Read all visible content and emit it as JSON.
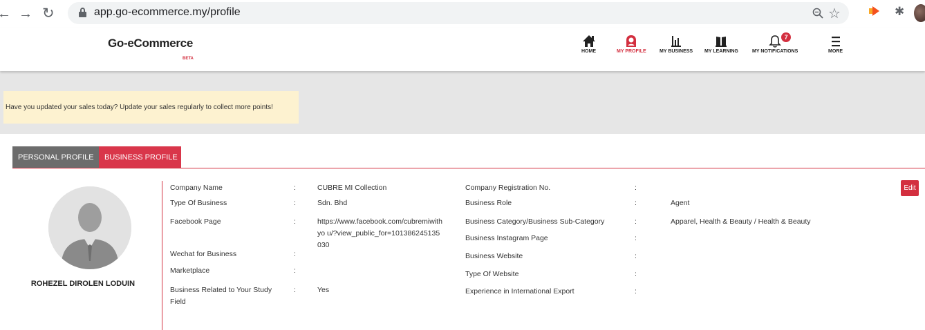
{
  "browser": {
    "url": "app.go-ecommerce.my/profile"
  },
  "header": {
    "logo": "Go-eCommerce",
    "beta": "BETA",
    "menu": [
      {
        "label": "HOME",
        "icon": "home-icon"
      },
      {
        "label": "MY PROFILE",
        "icon": "profile-icon"
      },
      {
        "label": "MY BUSINESS",
        "icon": "business-chart-icon"
      },
      {
        "label": "MY LEARNING",
        "icon": "book-icon"
      },
      {
        "label": "MY NOTIFICATIONS",
        "icon": "bell-icon"
      },
      {
        "label": "MORE",
        "icon": "hamburger-icon"
      }
    ],
    "notification_count": "7"
  },
  "notice": "Have you updated your sales today? Update your sales regularly to collect more points!",
  "tabs": {
    "personal": "PERSONAL PROFILE",
    "business": "BUSINESS PROFILE"
  },
  "profile": {
    "name": "ROHEZEL DIROLEN LODUIN"
  },
  "left_fields": [
    {
      "label": "Company Name",
      "value": "CUBRE MI Collection"
    },
    {
      "label": "Type Of Business",
      "value": "Sdn. Bhd"
    },
    {
      "label": "Facebook Page",
      "value": "https://www.facebook.com/cubremiwithyo u/?view_public_for=101386245135030"
    },
    {
      "label": "Wechat for Business",
      "value": ""
    },
    {
      "label": "Marketplace",
      "value": ""
    },
    {
      "label": "Business Related to Your Study Field",
      "value": "Yes"
    }
  ],
  "right_fields": [
    {
      "label": "Company Registration No.",
      "value": ""
    },
    {
      "label": "Business Role",
      "value": "Agent"
    },
    {
      "label": "Business Category/Business Sub-Category",
      "value": "Apparel, Health & Beauty / Health & Beauty"
    },
    {
      "label": "Business Instagram Page",
      "value": ""
    },
    {
      "label": "Business Website",
      "value": ""
    },
    {
      "label": "Type Of Website",
      "value": ""
    },
    {
      "label": "Experience in International Export",
      "value": ""
    }
  ],
  "separator": ":",
  "edit_label": "Edit",
  "colors": {
    "accent": "#d32f3f",
    "tab_inactive": "#6c6c6c",
    "notice_bg": "#fdf2d0"
  }
}
